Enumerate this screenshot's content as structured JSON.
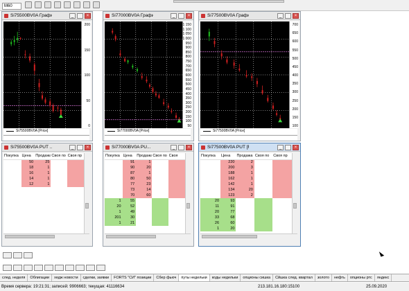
{
  "toolbar": {
    "interval": "M60"
  },
  "charts": [
    {
      "title": "Si75500BV0A Графи...",
      "legend": "Si75500BV0A [Price]",
      "ticks": [
        "200",
        "150",
        "100",
        "50",
        "0"
      ],
      "candles": [
        [
          10,
          195,
          205,
          190,
          200
        ],
        [
          14,
          200,
          215,
          192,
          205
        ],
        [
          18,
          205,
          225,
          198,
          210
        ],
        [
          22,
          210,
          212,
          205,
          208
        ],
        [
          28,
          170,
          180,
          160,
          168
        ],
        [
          34,
          165,
          172,
          150,
          155
        ],
        [
          40,
          145,
          150,
          120,
          130
        ],
        [
          46,
          100,
          110,
          80,
          90
        ],
        [
          50,
          70,
          80,
          58,
          62
        ],
        [
          54,
          60,
          65,
          48,
          52
        ],
        [
          60,
          55,
          60,
          40,
          45
        ],
        [
          64,
          45,
          50,
          28,
          32
        ],
        [
          70,
          40,
          46,
          30,
          38
        ],
        [
          74,
          35,
          40,
          20,
          22
        ]
      ],
      "ymin": 0,
      "ymax": 240,
      "hline": 45
    },
    {
      "title": "Si77000BV0A Графи...",
      "legend": "Si77000BV0A [Price]",
      "ticks": [
        "1 150",
        "1 100",
        "1 050",
        "1 000",
        "950",
        "900",
        "850",
        "800",
        "750",
        "700",
        "650",
        "600",
        "550",
        "500",
        "450",
        "400",
        "350",
        "300",
        "250",
        "200",
        "150",
        "100",
        "50"
      ],
      "candles": [
        [
          10,
          1120,
          1150,
          1080,
          1100
        ],
        [
          14,
          1060,
          1080,
          1000,
          1020
        ],
        [
          20,
          860,
          900,
          820,
          840
        ],
        [
          26,
          800,
          820,
          760,
          770
        ],
        [
          30,
          760,
          790,
          740,
          780
        ],
        [
          36,
          700,
          740,
          680,
          720
        ],
        [
          42,
          660,
          700,
          640,
          680
        ],
        [
          48,
          600,
          640,
          560,
          580
        ],
        [
          54,
          560,
          600,
          520,
          540
        ],
        [
          58,
          500,
          520,
          460,
          480
        ],
        [
          62,
          460,
          480,
          400,
          420
        ],
        [
          66,
          400,
          430,
          360,
          380
        ],
        [
          70,
          380,
          400,
          340,
          350
        ],
        [
          76,
          300,
          340,
          260,
          280
        ],
        [
          82,
          260,
          290,
          220,
          240
        ],
        [
          86,
          200,
          230,
          170,
          190
        ],
        [
          92,
          150,
          180,
          110,
          120
        ],
        [
          96,
          110,
          130,
          90,
          100
        ]
      ],
      "ymin": 50,
      "ymax": 1180,
      "hline": 100
    },
    {
      "title": "Si77500BV0A График ...",
      "legend": "Si77500BV0A [Price]",
      "ticks": [
        "700",
        "650",
        "600",
        "550",
        "500",
        "450",
        "400",
        "350",
        "300",
        "250",
        "200",
        "150",
        "100"
      ],
      "candles": [
        [
          10,
          650,
          700,
          620,
          680
        ],
        [
          16,
          620,
          640,
          580,
          600
        ],
        [
          24,
          540,
          560,
          500,
          520
        ],
        [
          30,
          500,
          520,
          470,
          480
        ],
        [
          38,
          480,
          500,
          440,
          460
        ],
        [
          44,
          440,
          470,
          420,
          430
        ],
        [
          52,
          400,
          430,
          380,
          390
        ],
        [
          58,
          390,
          410,
          360,
          380
        ],
        [
          64,
          360,
          380,
          320,
          340
        ],
        [
          70,
          300,
          330,
          270,
          280
        ],
        [
          76,
          250,
          270,
          220,
          230
        ],
        [
          82,
          200,
          220,
          170,
          180
        ],
        [
          86,
          150,
          170,
          130,
          140
        ],
        [
          90,
          120,
          140,
          100,
          110
        ]
      ],
      "ymin": 80,
      "ymax": 720,
      "hline": 550
    }
  ],
  "books": [
    {
      "title": "Si75500BV0A PUT ...",
      "headers": [
        "Покупка",
        "Цена",
        "Продажа",
        "Своя по",
        "Своя пр"
      ],
      "rows": [
        [
          "",
          "50",
          "25"
        ],
        [
          "",
          "18",
          "1"
        ],
        [
          "",
          "16",
          "1"
        ],
        [
          "",
          "14",
          "1"
        ],
        [
          "",
          "12",
          "1"
        ]
      ],
      "sell_rows": 5,
      "buy_rows": 0
    },
    {
      "title": "Si77000BV0A PU...",
      "headers": [
        "Покупка",
        "Цена",
        "Продажа",
        "Своя по",
        "Своя"
      ],
      "rows": [
        [
          "",
          "91",
          "1"
        ],
        [
          "",
          "90",
          "20"
        ],
        [
          "",
          "87",
          "1"
        ],
        [
          "",
          "80",
          "50"
        ],
        [
          "",
          "77",
          "23"
        ],
        [
          "",
          "73",
          "14"
        ],
        [
          "",
          "70",
          "60"
        ],
        [
          "1",
          "55",
          ""
        ],
        [
          "20",
          "52",
          ""
        ],
        [
          "1",
          "49",
          ""
        ],
        [
          "201",
          "30",
          ""
        ],
        [
          "1",
          "21",
          ""
        ]
      ],
      "sell_rows": 7,
      "buy_rows": 5
    },
    {
      "title": "Si77500BV0A PUT [FO...",
      "headers": [
        "Покупка",
        "Цена",
        "Продажа",
        "Своя по",
        "Своя пр"
      ],
      "rows": [
        [
          "",
          "220",
          "2"
        ],
        [
          "",
          "200",
          "3"
        ],
        [
          "",
          "188",
          "1"
        ],
        [
          "",
          "162",
          "1"
        ],
        [
          "",
          "142",
          "1"
        ],
        [
          "",
          "134",
          "20"
        ],
        [
          "",
          "123",
          "2"
        ],
        [
          "20",
          "93",
          ""
        ],
        [
          "11",
          "91",
          ""
        ],
        [
          "20",
          "77",
          ""
        ],
        [
          "33",
          "68",
          ""
        ],
        [
          "26",
          "60",
          ""
        ],
        [
          "1",
          "20",
          ""
        ]
      ],
      "sell_rows": 7,
      "buy_rows": 6
    }
  ],
  "tabs": [
    "след. неделя",
    "Облигации",
    "хедж новости",
    "сделки, заявки",
    "FORTS \"СИ\" позиции",
    "Сбер фьюч",
    "путы недельки",
    "коды недельки",
    "опционы сишка",
    "Сйшка след. квартал",
    "золото",
    "нефть",
    "опционы ртс",
    "яндекс"
  ],
  "active_tab": 6,
  "status": {
    "server_time": "Время сервера: 19:21:31; записей: 9906663; текущая: 41116634",
    "ip": "213.181.16.180:15100",
    "date": "25.09.2020"
  }
}
